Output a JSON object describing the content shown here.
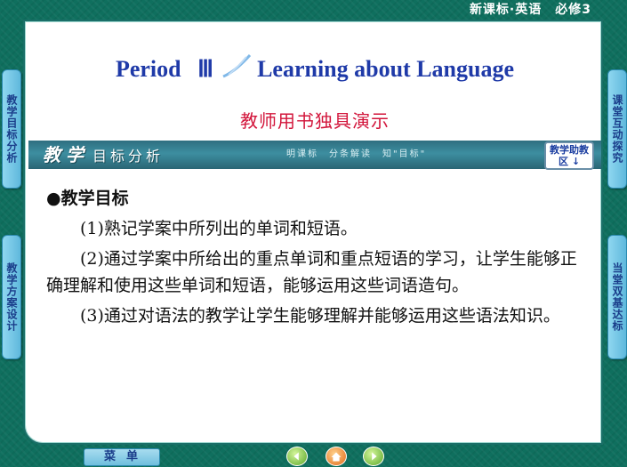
{
  "header": {
    "text": "新课标·英语　必修3"
  },
  "title": {
    "prefix": "Period",
    "numeral": "Ⅲ",
    "main": "Learning about Language"
  },
  "subtitle": "教师用书独具演示",
  "section": {
    "main_bold": "教学",
    "main_rest": "目标分析",
    "tagline": "明课标　分条解读　知\"目标\"",
    "button_label": "教学助教区",
    "button_arrow": "↓"
  },
  "content": {
    "heading": "●教学目标",
    "items": [
      "(1)熟记学案中所列出的单词和短语。",
      "(2)通过学案中所给出的重点单词和重点短语的学习，让学生能够正确理解和使用这些单词和短语，能够运用这些词语造句。",
      "(3)通过对语法的教学让学生能够理解并能够运用这些语法知识。"
    ]
  },
  "left_tabs": [
    "教学目标分析",
    "教学方案设计"
  ],
  "right_tabs": [
    "课堂互动探究",
    "当堂双基达标"
  ],
  "bottom": {
    "menu_label": "菜单"
  },
  "colors": {
    "background": "#0f6f5e",
    "title_blue": "#1f3aa8",
    "subtitle_red": "#d2143a",
    "section_teal": "#2e6f80",
    "tab_blue": "#8fd7f0"
  }
}
